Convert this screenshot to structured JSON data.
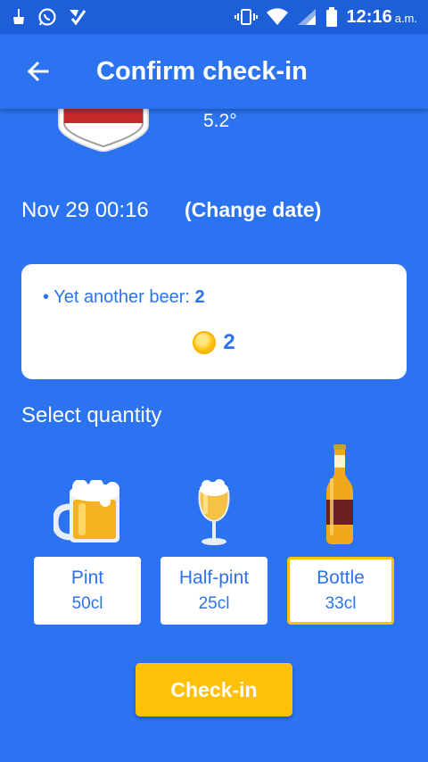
{
  "status_bar": {
    "time": "12:16",
    "ampm": "a.m."
  },
  "header": {
    "title": "Confirm check-in"
  },
  "beer": {
    "abv": "5.2°"
  },
  "checkin_date": {
    "date": "Nov 29 00:16",
    "change_label": "(Change date)"
  },
  "rewards": {
    "item_label": "• Yet another beer: ",
    "item_value": "2",
    "coins": "2"
  },
  "quantity": {
    "label": "Select quantity",
    "options": [
      {
        "name": "Pint",
        "volume": "50cl",
        "icon": "beer-mug-icon"
      },
      {
        "name": "Half-pint",
        "volume": "25cl",
        "icon": "beer-glass-icon"
      },
      {
        "name": "Bottle",
        "volume": "33cl",
        "icon": "beer-bottle-icon",
        "selected": true
      }
    ]
  },
  "actions": {
    "checkin_label": "Check-in"
  },
  "colors": {
    "primary": "#2b73f0",
    "accent": "#ffc107"
  }
}
